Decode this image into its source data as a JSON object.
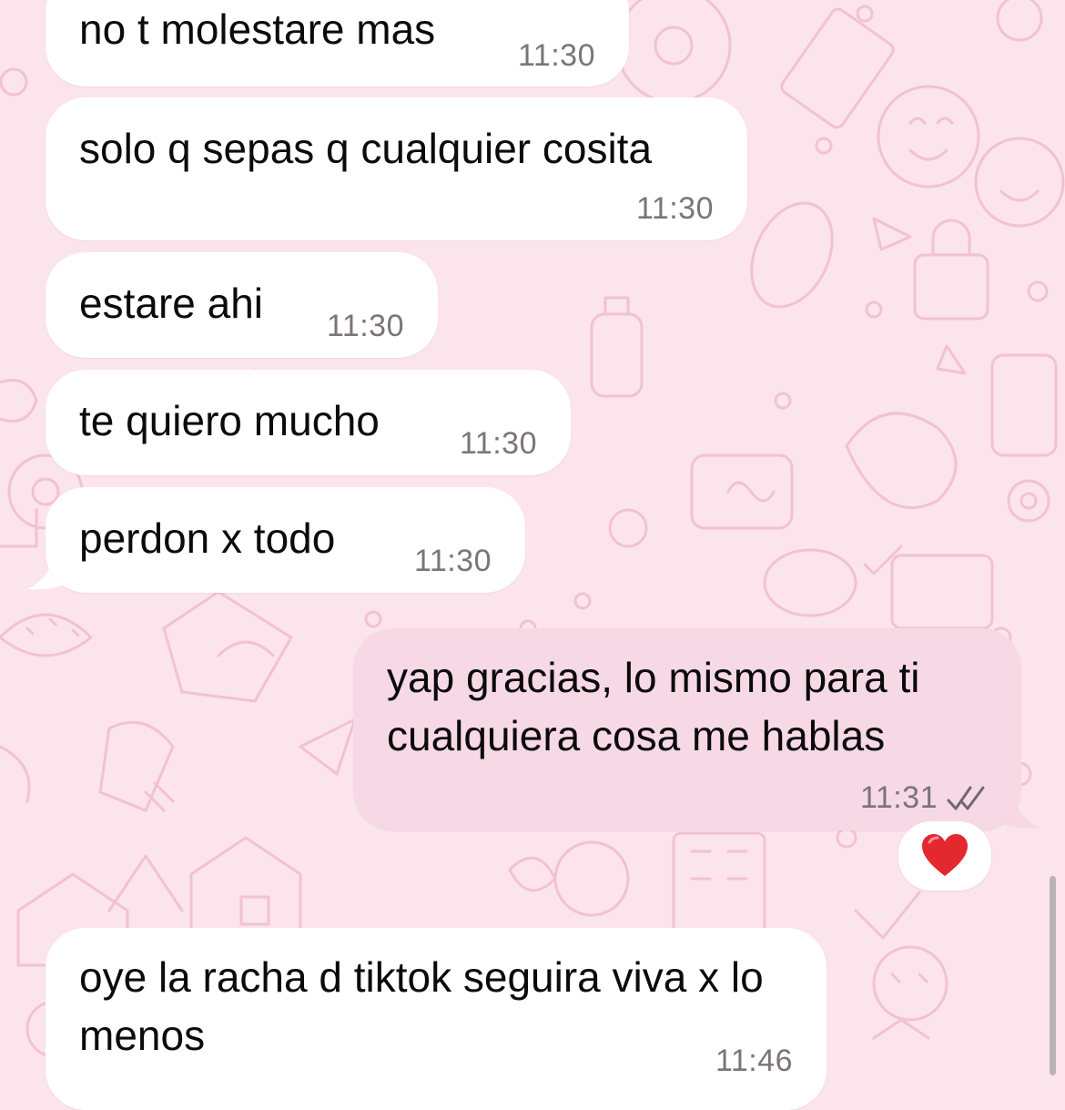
{
  "chat": {
    "colors": {
      "wallpaper": "#fbe4ec",
      "incoming_bubble": "#ffffff",
      "outgoing_bubble": "#f7d9e5",
      "timestamp": "#7c7478",
      "heart": "#e3282f"
    },
    "messages": [
      {
        "text": "no t molestare mas",
        "time": "11:30",
        "direction": "incoming"
      },
      {
        "text": "solo q sepas q cualquier cosita",
        "time": "11:30",
        "direction": "incoming"
      },
      {
        "text": "estare ahi",
        "time": "11:30",
        "direction": "incoming"
      },
      {
        "text": "te quiero mucho",
        "time": "11:30",
        "direction": "incoming"
      },
      {
        "text": "perdon x todo",
        "time": "11:30",
        "direction": "incoming"
      },
      {
        "text": "yap gracias, lo mismo para ti cualquiera cosa me hablas",
        "time": "11:31",
        "direction": "outgoing",
        "status": "read",
        "status_icon": "double-check-icon",
        "reaction": "❤️"
      },
      {
        "text": "oye la racha d tiktok seguira viva x lo menos",
        "time": "11:46",
        "direction": "incoming"
      }
    ]
  }
}
